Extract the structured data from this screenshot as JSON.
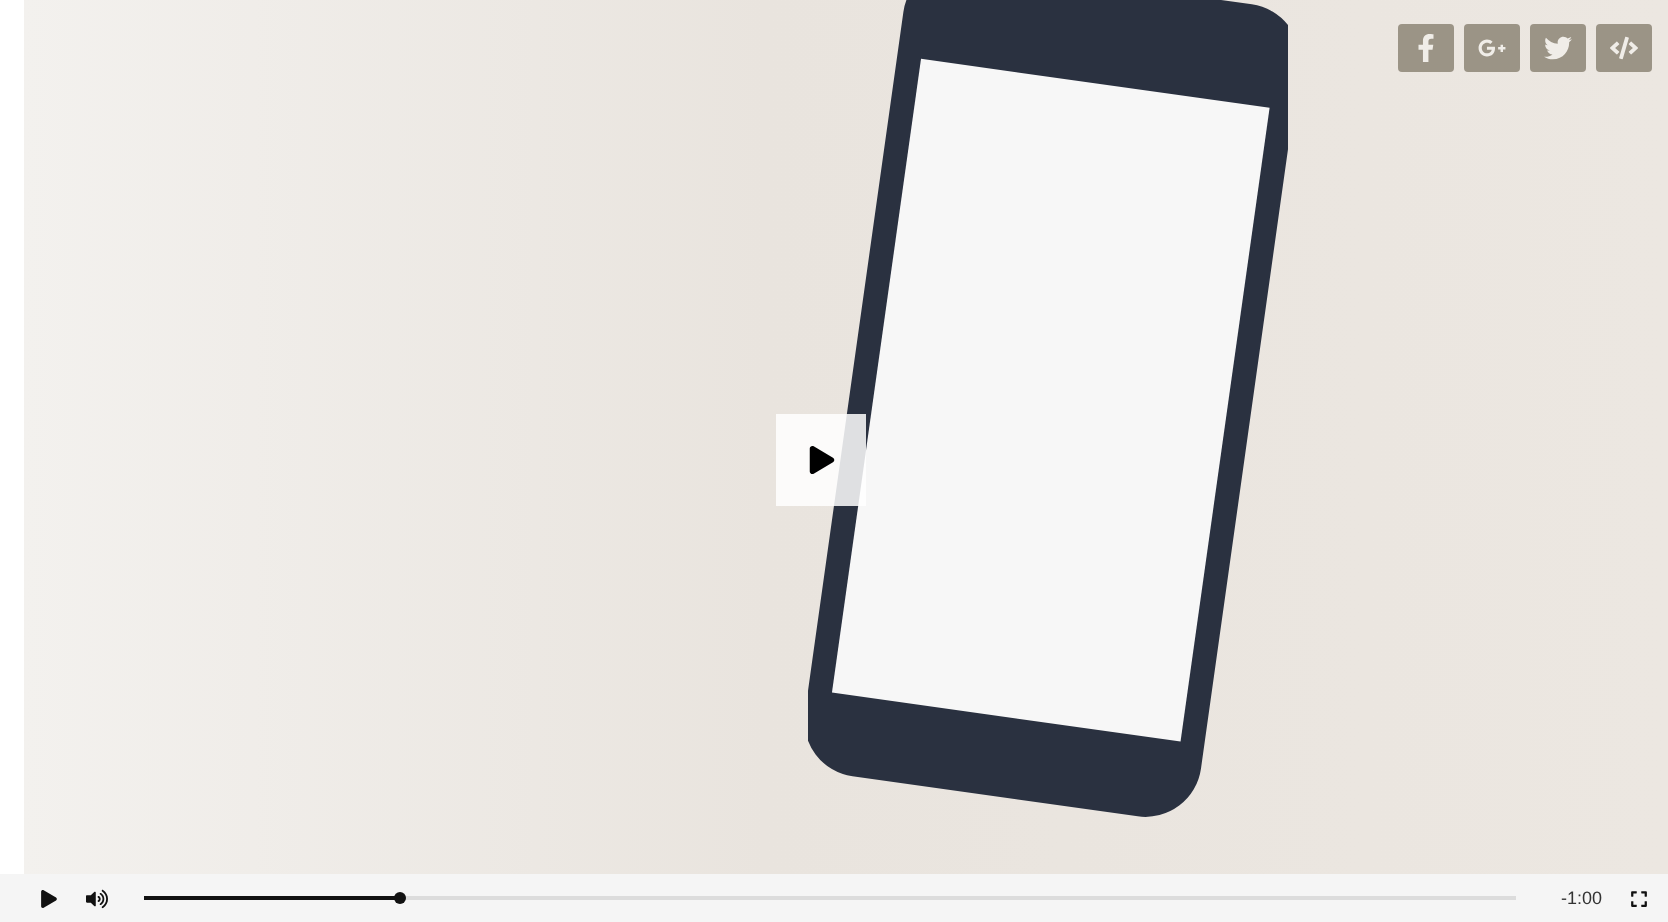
{
  "share_buttons": [
    {
      "kind": "facebook"
    },
    {
      "kind": "google"
    },
    {
      "kind": "twitter"
    },
    {
      "kind": "embed"
    }
  ],
  "player": {
    "playing": false,
    "muted": false,
    "progress": {
      "level": 0.186
    },
    "time": "-1:00"
  }
}
